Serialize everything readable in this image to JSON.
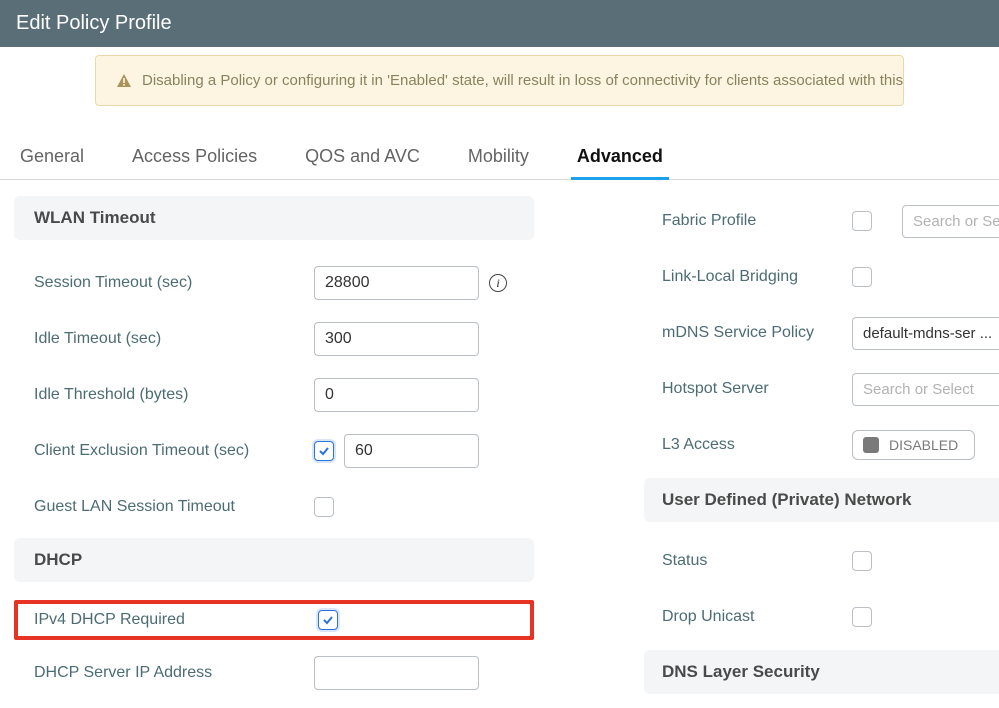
{
  "header": {
    "title": "Edit Policy Profile"
  },
  "alert": {
    "text": "Disabling a Policy or configuring it in 'Enabled' state, will result in loss of connectivity for clients associated with this Polic"
  },
  "tabs": {
    "general": "General",
    "access_policies": "Access Policies",
    "qos_avc": "QOS and AVC",
    "mobility": "Mobility",
    "advanced": "Advanced"
  },
  "left": {
    "wlan_timeout_header": "WLAN Timeout",
    "session_timeout_label": "Session Timeout (sec)",
    "session_timeout_value": "28800",
    "idle_timeout_label": "Idle Timeout (sec)",
    "idle_timeout_value": "300",
    "idle_threshold_label": "Idle Threshold (bytes)",
    "idle_threshold_value": "0",
    "client_exclusion_label": "Client Exclusion Timeout (sec)",
    "client_exclusion_value": "60",
    "guest_lan_label": "Guest LAN Session Timeout",
    "dhcp_header": "DHCP",
    "ipv4_dhcp_required_label": "IPv4 DHCP Required",
    "dhcp_server_ip_label": "DHCP Server IP Address",
    "dhcp_server_ip_value": ""
  },
  "right": {
    "fabric_profile_label": "Fabric Profile",
    "fabric_profile_placeholder": "Search or Select",
    "link_local_label": "Link-Local Bridging",
    "mdns_label": "mDNS Service Policy",
    "mdns_value": "default-mdns-ser ...",
    "hotspot_label": "Hotspot Server",
    "hotspot_placeholder": "Search or Select",
    "l3_label": "L3 Access",
    "l3_value": "DISABLED",
    "udn_header": "User Defined (Private) Network",
    "status_label": "Status",
    "drop_unicast_label": "Drop Unicast",
    "dns_header": "DNS Layer Security"
  }
}
